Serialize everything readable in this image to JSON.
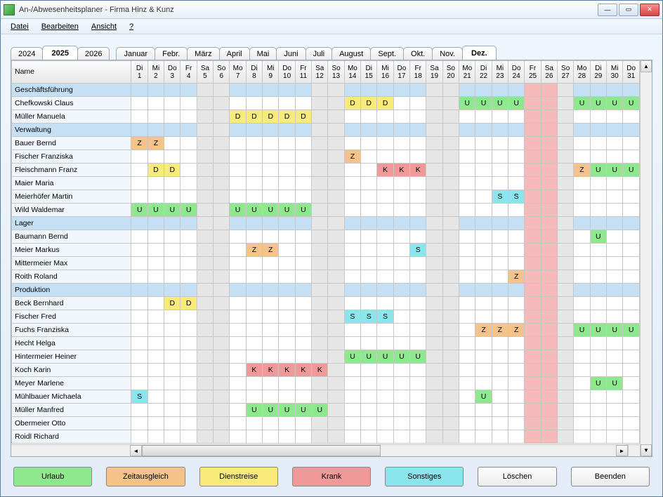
{
  "window": {
    "title": "An-/Abwesenheitsplaner - Firma Hinz & Kunz"
  },
  "menu": {
    "file": "Datei",
    "edit": "Bearbeiten",
    "view": "Ansicht",
    "help": "?"
  },
  "years": [
    "2024",
    "2025",
    "2026"
  ],
  "active_year": "2025",
  "months": [
    "Januar",
    "Febr.",
    "März",
    "April",
    "Mai",
    "Juni",
    "Juli",
    "August",
    "Sept.",
    "Okt.",
    "Nov.",
    "Dez."
  ],
  "active_month": "Dez.",
  "name_header": "Name",
  "days": [
    {
      "wd": "Di",
      "d": "1",
      "we": false,
      "hol": false
    },
    {
      "wd": "Mi",
      "d": "2",
      "we": false,
      "hol": false
    },
    {
      "wd": "Do",
      "d": "3",
      "we": false,
      "hol": false
    },
    {
      "wd": "Fr",
      "d": "4",
      "we": false,
      "hol": false
    },
    {
      "wd": "Sa",
      "d": "5",
      "we": true,
      "hol": false
    },
    {
      "wd": "So",
      "d": "6",
      "we": true,
      "hol": false
    },
    {
      "wd": "Mo",
      "d": "7",
      "we": false,
      "hol": false
    },
    {
      "wd": "Di",
      "d": "8",
      "we": false,
      "hol": false
    },
    {
      "wd": "Mi",
      "d": "9",
      "we": false,
      "hol": false
    },
    {
      "wd": "Do",
      "d": "10",
      "we": false,
      "hol": false
    },
    {
      "wd": "Fr",
      "d": "11",
      "we": false,
      "hol": false
    },
    {
      "wd": "Sa",
      "d": "12",
      "we": true,
      "hol": false
    },
    {
      "wd": "So",
      "d": "13",
      "we": true,
      "hol": false
    },
    {
      "wd": "Mo",
      "d": "14",
      "we": false,
      "hol": false
    },
    {
      "wd": "Di",
      "d": "15",
      "we": false,
      "hol": false
    },
    {
      "wd": "Mi",
      "d": "16",
      "we": false,
      "hol": false
    },
    {
      "wd": "Do",
      "d": "17",
      "we": false,
      "hol": false
    },
    {
      "wd": "Fr",
      "d": "18",
      "we": false,
      "hol": false
    },
    {
      "wd": "Sa",
      "d": "19",
      "we": true,
      "hol": false
    },
    {
      "wd": "So",
      "d": "20",
      "we": true,
      "hol": false
    },
    {
      "wd": "Mo",
      "d": "21",
      "we": false,
      "hol": false
    },
    {
      "wd": "Di",
      "d": "22",
      "we": false,
      "hol": false
    },
    {
      "wd": "Mi",
      "d": "23",
      "we": false,
      "hol": false
    },
    {
      "wd": "Do",
      "d": "24",
      "we": false,
      "hol": false
    },
    {
      "wd": "Fr",
      "d": "25",
      "we": false,
      "hol": true
    },
    {
      "wd": "Sa",
      "d": "26",
      "we": false,
      "hol": true
    },
    {
      "wd": "So",
      "d": "27",
      "we": true,
      "hol": false
    },
    {
      "wd": "Mo",
      "d": "28",
      "we": false,
      "hol": false
    },
    {
      "wd": "Di",
      "d": "29",
      "we": false,
      "hol": false
    },
    {
      "wd": "Mi",
      "d": "30",
      "we": false,
      "hol": false
    },
    {
      "wd": "Do",
      "d": "31",
      "we": false,
      "hol": false
    }
  ],
  "rows": [
    {
      "type": "group",
      "label": "Geschäftsführung"
    },
    {
      "type": "person",
      "label": "Chefkowski Claus",
      "cells": {
        "14": "D",
        "15": "D",
        "16": "D",
        "21": "U",
        "22": "U",
        "23": "U",
        "24": "U",
        "28": "U",
        "29": "U",
        "30": "U",
        "31": "U"
      }
    },
    {
      "type": "person",
      "label": "Müller Manuela",
      "cells": {
        "7": "D",
        "8": "D",
        "9": "D",
        "10": "D",
        "11": "D"
      }
    },
    {
      "type": "group",
      "label": "Verwaltung"
    },
    {
      "type": "person",
      "label": "Bauer Bernd",
      "cells": {
        "1": "Z",
        "2": "Z"
      }
    },
    {
      "type": "person",
      "label": "Fischer Franziska",
      "cells": {
        "14": "Z"
      }
    },
    {
      "type": "person",
      "label": "Fleischmann Franz",
      "cells": {
        "2": "D",
        "3": "D",
        "16": "K",
        "17": "K",
        "18": "K",
        "28": "Z",
        "29": "U",
        "30": "U",
        "31": "U"
      }
    },
    {
      "type": "person",
      "label": "Maier Maria",
      "cells": {}
    },
    {
      "type": "person",
      "label": "Meierhöfer Martin",
      "cells": {
        "23": "S",
        "24": "S"
      }
    },
    {
      "type": "person",
      "label": "Wild Waldemar",
      "cells": {
        "1": "U",
        "2": "U",
        "3": "U",
        "4": "U",
        "7": "U",
        "8": "U",
        "9": "U",
        "10": "U",
        "11": "U"
      }
    },
    {
      "type": "group",
      "label": "Lager"
    },
    {
      "type": "person",
      "label": "Baumann Bernd",
      "cells": {
        "29": "U"
      }
    },
    {
      "type": "person",
      "label": "Meier Markus",
      "cells": {
        "8": "Z",
        "9": "Z",
        "18": "S"
      }
    },
    {
      "type": "person",
      "label": "Mittermeier Max",
      "cells": {}
    },
    {
      "type": "person",
      "label": "Roith Roland",
      "cells": {
        "24": "Z"
      }
    },
    {
      "type": "group",
      "label": "Produktion"
    },
    {
      "type": "person",
      "label": "Beck Bernhard",
      "cells": {
        "3": "D",
        "4": "D"
      }
    },
    {
      "type": "person",
      "label": "Fischer Fred",
      "cells": {
        "14": "S",
        "15": "S",
        "16": "S"
      }
    },
    {
      "type": "person",
      "label": "Fuchs Franziska",
      "cells": {
        "22": "Z",
        "23": "Z",
        "24": "Z",
        "28": "U",
        "29": "U",
        "30": "U",
        "31": "U"
      }
    },
    {
      "type": "person",
      "label": "Hecht Helga",
      "cells": {}
    },
    {
      "type": "person",
      "label": "Hintermeier Heiner",
      "cells": {
        "14": "U",
        "15": "U",
        "16": "U",
        "17": "U",
        "18": "U"
      }
    },
    {
      "type": "person",
      "label": "Koch Karin",
      "cells": {
        "8": "K",
        "9": "K",
        "10": "K",
        "11": "K",
        "12": "K"
      }
    },
    {
      "type": "person",
      "label": "Meyer Marlene",
      "cells": {
        "29": "U",
        "30": "U"
      }
    },
    {
      "type": "person",
      "label": "Mühlbauer Michaela",
      "cells": {
        "1": "S",
        "22": "U"
      }
    },
    {
      "type": "person",
      "label": "Müller Manfred",
      "cells": {
        "8": "U",
        "9": "U",
        "10": "U",
        "11": "U",
        "12": "U"
      }
    },
    {
      "type": "person",
      "label": "Obermeier Otto",
      "cells": {}
    },
    {
      "type": "person",
      "label": "Roidl Richard",
      "cells": {}
    }
  ],
  "buttons": {
    "urlaub": "Urlaub",
    "zeit": "Zeitausgleich",
    "dienst": "Dienstreise",
    "krank": "Krank",
    "sonst": "Sonstiges",
    "loeschen": "Löschen",
    "beenden": "Beenden"
  }
}
